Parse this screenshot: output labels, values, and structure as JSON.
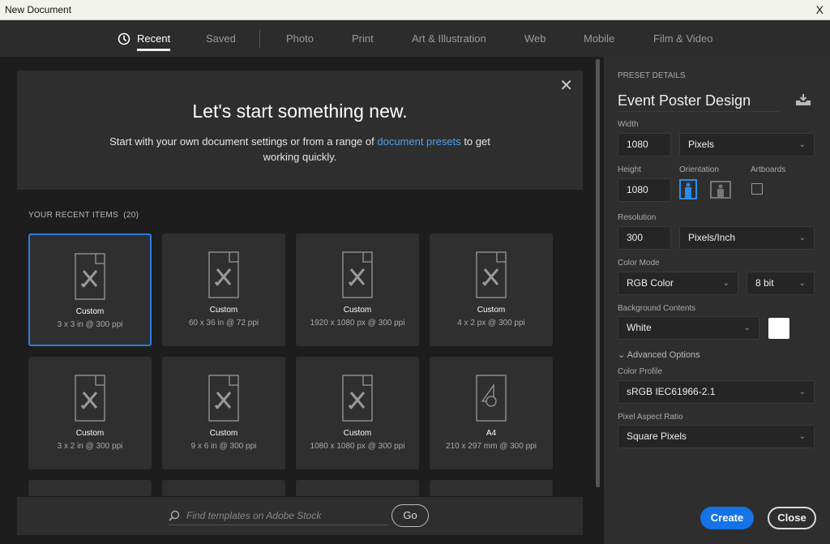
{
  "window": {
    "title": "New Document",
    "close": "X"
  },
  "tabs": [
    {
      "label": "Recent",
      "icon": "clock-icon"
    },
    {
      "label": "Saved"
    },
    {
      "label": "Photo"
    },
    {
      "label": "Print"
    },
    {
      "label": "Art & Illustration"
    },
    {
      "label": "Web"
    },
    {
      "label": "Mobile"
    },
    {
      "label": "Film & Video"
    }
  ],
  "hero": {
    "title": "Let's start something new.",
    "text_before": "Start with your own document settings or from a range of ",
    "link": "document presets",
    "text_after": " to get working quickly.",
    "close": "✕"
  },
  "recent": {
    "heading": "YOUR RECENT ITEMS",
    "count": "(20)",
    "items": [
      {
        "title": "Custom",
        "spec": "3 x 3 in @ 300 ppi",
        "icon": "custom-doc-icon",
        "selected": true
      },
      {
        "title": "Custom",
        "spec": "60 x 36 in @ 72 ppi",
        "icon": "custom-doc-icon"
      },
      {
        "title": "Custom",
        "spec": "1920 x 1080 px @ 300 ppi",
        "icon": "custom-doc-icon"
      },
      {
        "title": "Custom",
        "spec": "4 x 2 px @ 300 ppi",
        "icon": "custom-doc-icon"
      },
      {
        "title": "Custom",
        "spec": "3 x 2 in @ 300 ppi",
        "icon": "custom-doc-icon"
      },
      {
        "title": "Custom",
        "spec": "9 x 6 in @ 300 ppi",
        "icon": "custom-doc-icon"
      },
      {
        "title": "Custom",
        "spec": "1080 x 1080 px @ 300 ppi",
        "icon": "custom-doc-icon"
      },
      {
        "title": "A4",
        "spec": "210 x 297 mm @ 300 ppi",
        "icon": "shapes-doc-icon"
      }
    ]
  },
  "search": {
    "placeholder": "Find templates on Adobe Stock",
    "go": "Go"
  },
  "preset": {
    "heading": "PRESET DETAILS",
    "name": "Event Poster Design",
    "width_label": "Width",
    "width": "1080",
    "width_unit": "Pixels",
    "height_label": "Height",
    "height": "1080",
    "orientation_label": "Orientation",
    "orientation": "portrait",
    "artboards_label": "Artboards",
    "artboards": false,
    "resolution_label": "Resolution",
    "resolution": "300",
    "resolution_unit": "Pixels/Inch",
    "color_mode_label": "Color Mode",
    "color_mode": "RGB Color",
    "bit_depth": "8 bit",
    "bg_label": "Background Contents",
    "bg": "White",
    "bg_color": "#ffffff",
    "advanced": "Advanced Options",
    "profile_label": "Color Profile",
    "profile": "sRGB IEC61966-2.1",
    "par_label": "Pixel Aspect Ratio",
    "par": "Square Pixels"
  },
  "buttons": {
    "create": "Create",
    "close": "Close"
  },
  "colors": {
    "accent": "#1473e6",
    "link": "#4ca2f5"
  }
}
